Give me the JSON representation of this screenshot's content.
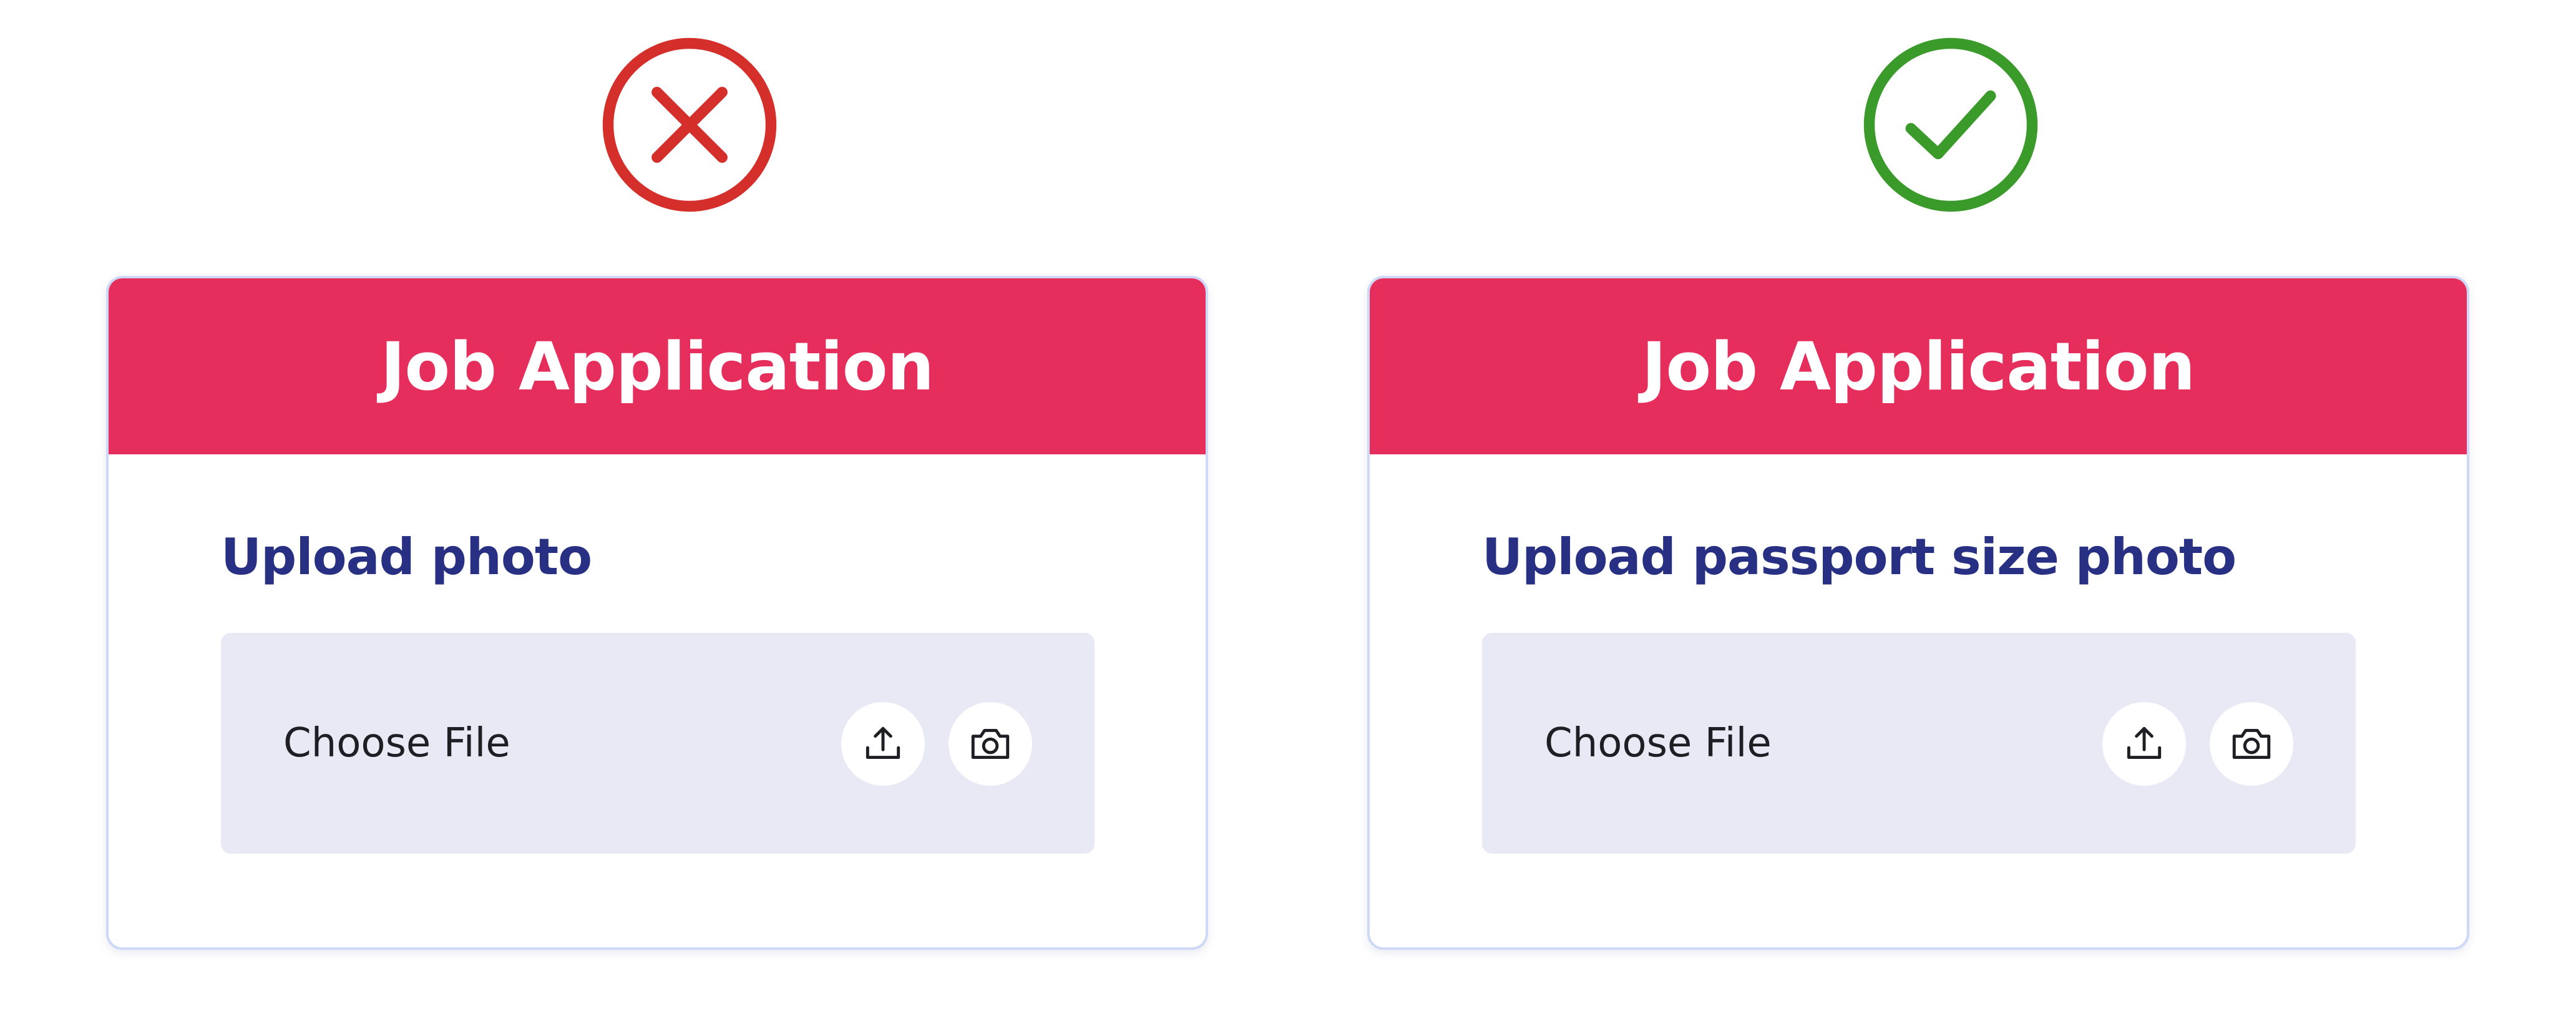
{
  "colors": {
    "header": "#e62e5c",
    "label": "#283084",
    "file_box": "#e9e9f6",
    "bad": "#d42f2a",
    "good": "#3a9a2a"
  },
  "examples": [
    {
      "verdict": "incorrect",
      "verdict_icon": "x-mark-circle-icon",
      "form": {
        "title": "Job Application",
        "field_label": "Upload photo",
        "file_input": {
          "text": "Choose File",
          "actions": [
            "upload-icon",
            "camera-icon"
          ]
        }
      }
    },
    {
      "verdict": "correct",
      "verdict_icon": "checkmark-circle-icon",
      "form": {
        "title": "Job Application",
        "field_label": "Upload passport size photo",
        "file_input": {
          "text": "Choose File",
          "actions": [
            "upload-icon",
            "camera-icon"
          ]
        }
      }
    }
  ]
}
